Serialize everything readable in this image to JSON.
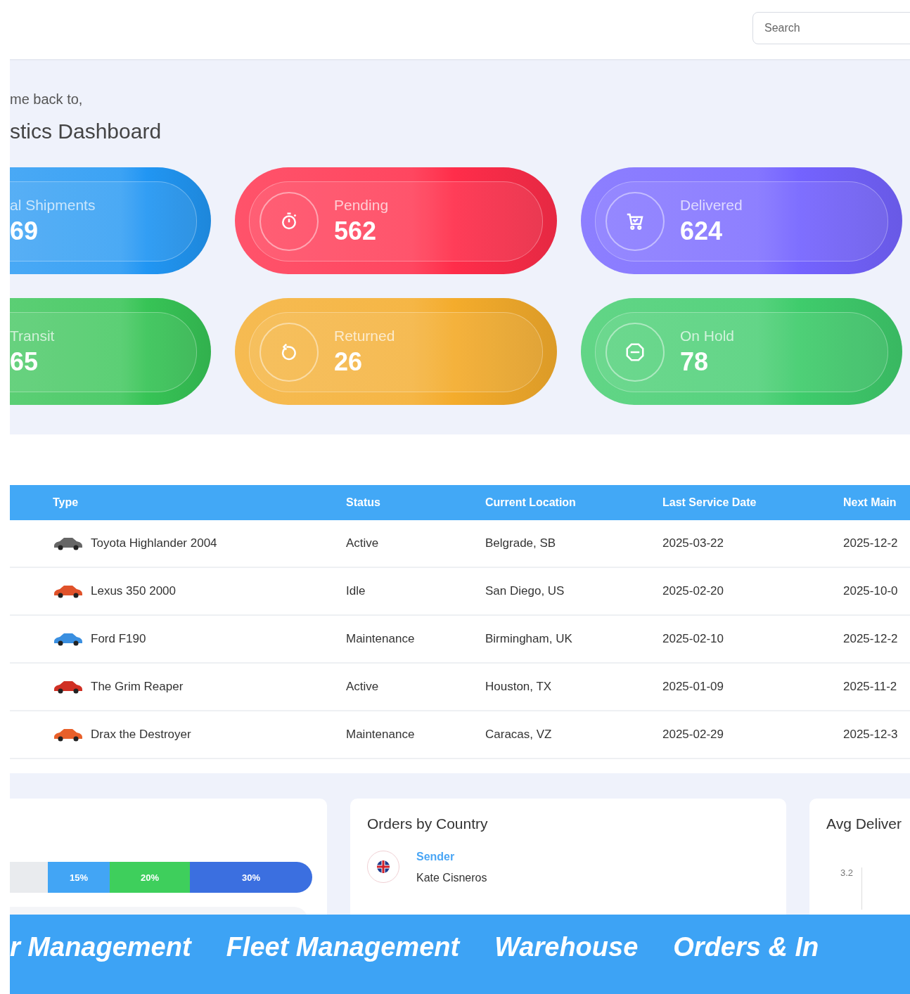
{
  "header": {
    "search": {
      "placeholder": "Search"
    }
  },
  "welcome": {
    "greeting": "me back to,",
    "title": "stics Dashboard"
  },
  "stats": [
    {
      "label": "al Shipments",
      "value": "69",
      "color": "#2196f3",
      "kind": "plain"
    },
    {
      "label": "Pending",
      "value": "562",
      "color": "#ff2d4a",
      "kind": "timer"
    },
    {
      "label": "Delivered",
      "value": "624",
      "color": "#7463ff",
      "kind": "cart"
    },
    {
      "label": "Transit",
      "value": "65",
      "color": "#37c456",
      "kind": "plain"
    },
    {
      "label": "Returned",
      "value": "26",
      "color": "#f4ac2c",
      "kind": "undo"
    },
    {
      "label": "On Hold",
      "value": "78",
      "color": "#3fcc6c",
      "kind": "stop"
    }
  ],
  "table": {
    "columns": [
      "Type",
      "Status",
      "Current Location",
      "Last Service Date",
      "Next Main"
    ],
    "rows": [
      {
        "type": "Toyota Highlander 2004",
        "color": "#666666",
        "status": "Active",
        "location": "Belgrade, SB",
        "last_service": "2025-03-22",
        "next": "2025-12-2"
      },
      {
        "type": "Lexus 350 2000",
        "color": "#e0522a",
        "status": "Idle",
        "location": "San Diego, US",
        "last_service": "2025-02-20",
        "next": "2025-10-0"
      },
      {
        "type": "Ford F190",
        "color": "#3a8fe0",
        "status": "Maintenance",
        "location": "Birmingham, UK",
        "last_service": "2025-02-10",
        "next": "2025-12-2"
      },
      {
        "type": "The Grim Reaper",
        "color": "#d03024",
        "status": "Active",
        "location": "Houston, TX",
        "last_service": "2025-01-09",
        "next": "2025-11-2"
      },
      {
        "type": "Drax the Destroyer",
        "color": "#e8602a",
        "status": "Maintenance",
        "location": "Caracas, VZ",
        "last_service": "2025-02-29",
        "next": "2025-12-3"
      }
    ]
  },
  "panels": {
    "progress": {
      "segments": [
        {
          "label": "15%",
          "color": "#42a5f5"
        },
        {
          "label": "20%",
          "color": "#3ecf5c"
        },
        {
          "label": "30%",
          "color": "#3b6fe0"
        }
      ]
    },
    "orders": {
      "title": "Orders by Country",
      "role": "Sender",
      "name": "Kate Cisneros"
    },
    "delivery": {
      "title": "Avg Deliver",
      "tick": "3.2"
    }
  },
  "banner": [
    "r Management",
    "Fleet Management",
    "Warehouse",
    "Orders & In"
  ]
}
